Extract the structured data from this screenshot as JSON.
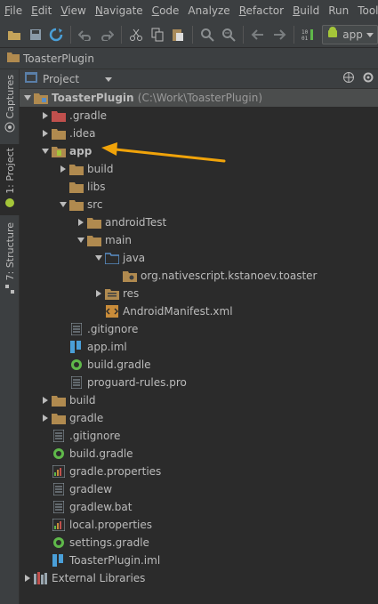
{
  "menu": [
    {
      "mnemonic": "F",
      "rest": "ile"
    },
    {
      "mnemonic": "E",
      "rest": "dit"
    },
    {
      "mnemonic": "V",
      "rest": "iew"
    },
    {
      "mnemonic": "N",
      "rest": "avigate"
    },
    {
      "mnemonic": "C",
      "rest": "ode"
    },
    {
      "mnemonic": "",
      "rest": "Analyze"
    },
    {
      "mnemonic": "R",
      "rest": "efactor"
    },
    {
      "mnemonic": "B",
      "rest": "uild"
    },
    {
      "mnemonic": "",
      "rest": "Run"
    },
    {
      "mnemonic": "",
      "rest": "Tools"
    }
  ],
  "toolbar": {
    "run_config_label": "app",
    "icons": [
      "open-folder-icon",
      "save-icon",
      "sync-icon",
      "undo-icon",
      "redo-icon",
      "cut-icon",
      "copy-icon",
      "paste-icon",
      "find-icon",
      "replace-icon",
      "back-icon",
      "forward-icon",
      "make-icon"
    ]
  },
  "breadcrumb": {
    "label": "ToasterPlugin"
  },
  "left_strip": {
    "captures": "Captures",
    "project": "1: Project",
    "structure": "7: Structure"
  },
  "panel": {
    "view_label": "Project"
  },
  "tree": {
    "root": {
      "name": "ToasterPlugin",
      "path": "(C:\\Work\\ToasterPlugin)"
    },
    "items": {
      "gradle_hidden": ".gradle",
      "idea": ".idea",
      "app": "app",
      "app_build": "build",
      "app_libs": "libs",
      "app_src": "src",
      "android_test": "androidTest",
      "main": "main",
      "java": "java",
      "package": "org.nativescript.kstanoev.toaster",
      "res": "res",
      "manifest": "AndroidManifest.xml",
      "app_gitignore": ".gitignore",
      "app_iml": "app.iml",
      "app_build_gradle": "build.gradle",
      "proguard": "proguard-rules.pro",
      "build": "build",
      "gradle": "gradle",
      "gitignore": ".gitignore",
      "build_gradle": "build.gradle",
      "gradle_properties": "gradle.properties",
      "gradlew": "gradlew",
      "gradlew_bat": "gradlew.bat",
      "local_properties": "local.properties",
      "settings_gradle": "settings.gradle",
      "toaster_iml": "ToasterPlugin.iml",
      "external_libraries": "External Libraries"
    }
  },
  "colors": {
    "folder": "#b08a4f",
    "excluded_folder": "#c0504d",
    "module_folder": "#b08a4f",
    "source_folder": "#5a8fc7",
    "gradle_green": "#5fb84a",
    "callout_arrow": "#f0a30a",
    "selection": "#4b4d4d"
  }
}
